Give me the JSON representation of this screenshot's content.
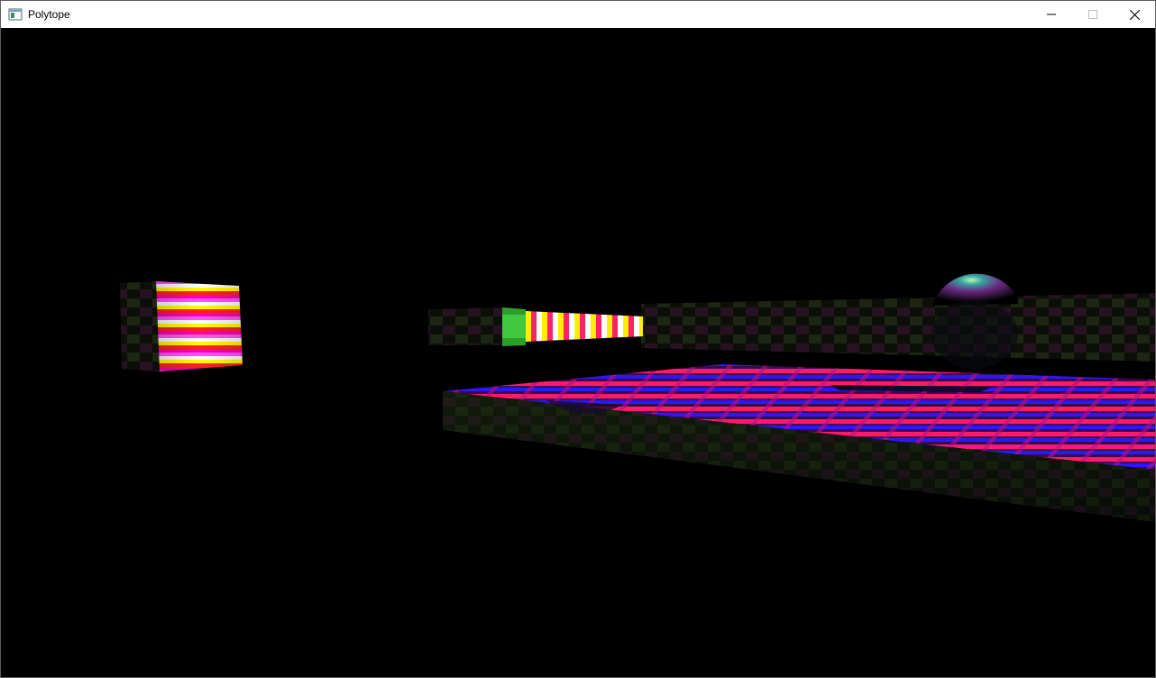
{
  "window": {
    "title": "Polytope",
    "icon": "app-window-icon",
    "controls": [
      "minimize-icon",
      "maximize-icon",
      "close-icon"
    ]
  },
  "scene": {
    "background_color": "#000000",
    "objects": [
      "textured-cube",
      "textured-bar",
      "long-dark-slab",
      "shaded-sphere",
      "checkered-floor-platform"
    ],
    "texture_colors": [
      "#ff00ff",
      "#ffff00",
      "#ff0000",
      "#ffffff",
      "#0000ff",
      "#00ff00"
    ]
  }
}
